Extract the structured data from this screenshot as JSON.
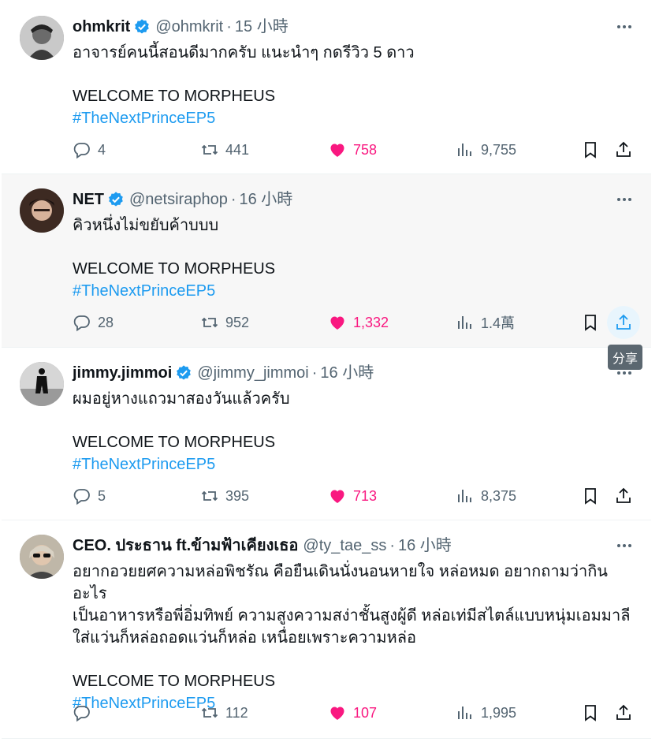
{
  "tweets": [
    {
      "name": "ohmkrit",
      "handle": "@ohmkrit",
      "dot": "·",
      "time": "15 小時",
      "line1": "อาจารย์คนนี้สอนดีมากครับ แนะนำๆ กดรีวิว 5 ดาว",
      "line2": "",
      "line3": "",
      "welcome": "WELCOME TO MORPHEUS",
      "hashtag": "#TheNextPrinceEP5",
      "replies": "4",
      "retweets": "441",
      "likes": "758",
      "views": "9,755"
    },
    {
      "name": "NET",
      "handle": "@netsiraphop",
      "dot": "·",
      "time": "16 小時",
      "line1": "คิวหนึ่งไม่ขยับค้าบบบ",
      "line2": "",
      "line3": "",
      "welcome": "WELCOME TO MORPHEUS",
      "hashtag": "#TheNextPrinceEP5",
      "replies": "28",
      "retweets": "952",
      "likes": "1,332",
      "views": "1.4萬"
    },
    {
      "name": "jimmy.jimmoi",
      "handle": "@jimmy_jimmoi",
      "dot": "·",
      "time": "16 小時",
      "line1": "ผมอยู่หางแถวมาสองวันแล้วครับ",
      "line2": "",
      "line3": "",
      "welcome": "WELCOME TO MORPHEUS",
      "hashtag": "#TheNextPrinceEP5",
      "replies": "5",
      "retweets": "395",
      "likes": "713",
      "views": "8,375"
    },
    {
      "name": "CEO. ประธาน ft.ข้ามฟ้าเคียงเธอ",
      "handle": "@ty_tae_ss",
      "dot": "·",
      "time": "16 小時",
      "line1": "อยากอวยยศความหล่อพิชรัณ คือยืนเดินนั่งนอนหายใจ หล่อหมด อยากถามว่ากินอะไร",
      "line2": "เป็นอาหารหรือพี่อิ่มทิพย์ ความสูงความสง่าชั้นสูงผู้ดี หล่อเท่มีสไตล์แบบหนุ่มเอมมาลี",
      "line3": "ใส่แว่นก็หล่อถอดแว่นก็หล่อ เหนื่อยเพราะความหล่อ",
      "welcome": "WELCOME TO MORPHEUS",
      "hashtag": "#TheNextPrinceEP5",
      "replies": "",
      "retweets": "112",
      "likes": "107",
      "views": "1,995"
    }
  ],
  "tooltip": {
    "share_label": "分享"
  },
  "colors": {
    "like": "#f91880",
    "link": "#1d9bf0",
    "muted": "#536471",
    "verified": "#1d9bf0"
  },
  "icons": [
    "verified-badge-icon",
    "more-icon",
    "reply-icon",
    "retweet-icon",
    "heart-icon",
    "views-icon",
    "bookmark-icon",
    "share-icon"
  ]
}
